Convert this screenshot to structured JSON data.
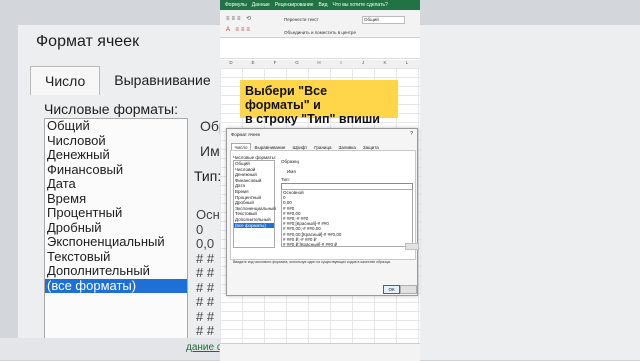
{
  "background_dialog": {
    "title": "Формат ячеек",
    "help": "?",
    "tabs": [
      "Число",
      "Выравнивание",
      "Шр"
    ],
    "formats_label": "Числовые форматы:",
    "formats": [
      "Общий",
      "Числовой",
      "Денежный",
      "Финансовый",
      "Дата",
      "Время",
      "Процентный",
      "Дробный",
      "Экспоненциальный",
      "Текстовый",
      "Дополнительный",
      "(все форматы)"
    ],
    "selected_index": 11,
    "right_a": "Обр",
    "right_b": "Им",
    "type_label": "Тип:",
    "col_values": [
      "Осн",
      "0",
      "0,0",
      "# #",
      "# #",
      "# #",
      "# #",
      "# #",
      "# #"
    ],
    "sheet_tab": "дание форм",
    "add_sheet": "+"
  },
  "excel": {
    "ribbon_tabs": [
      "Формулы",
      "Данные",
      "Рецензирование",
      "Вид",
      "Что вы хотите сделать?"
    ],
    "wrap_text": "Перенести текст",
    "merge_center": "Объединить и поместить в центре",
    "alignment_group": "Выравнивание",
    "number_format": "Общий",
    "columns": [
      "D",
      "E",
      "F",
      "G",
      "H",
      "I",
      "J",
      "K",
      "L"
    ]
  },
  "banner": {
    "line1": "Выбери \"Все форматы\" и",
    "line2": "в строку \"Тип\" впиши @\"_"
  },
  "dialog": {
    "title": "Формат ячеек",
    "help": "?",
    "tabs": [
      "Число",
      "Выравнивание",
      "Шрифт",
      "Граница",
      "Заливка",
      "Защита"
    ],
    "formats_label": "Числовые форматы:",
    "formats": [
      "Общий",
      "Числовой",
      "Денежный",
      "Финансовый",
      "Дата",
      "Время",
      "Процентный",
      "Дробный",
      "Экспоненциальный",
      "Текстовый",
      "Дополнительный",
      "(все форматы)"
    ],
    "selected_index": 11,
    "sample_label": "Образец",
    "sample_value": "Имя",
    "type_label": "Тип:",
    "type_value": "",
    "types": [
      "Основной",
      "0",
      "0,00",
      "# ##0",
      "# ##0,00",
      "# ##0;-# ##0",
      "# ##0;[Красный]-# ##0",
      "# ##0,00;-# ##0,00",
      "# ##0,00;[Красный]-# ##0,00",
      "# ##0 ₽;-# ##0 ₽",
      "# ##0 ₽;[Красный]-# ##0 ₽"
    ],
    "hint": "Введите код числового формата, используя один из существующих кодов в качестве образца.",
    "ok_label": "ОК"
  },
  "colors": {
    "excel_green": "#217346",
    "banner": "#ffd64a",
    "selection": "#1e70d6"
  }
}
